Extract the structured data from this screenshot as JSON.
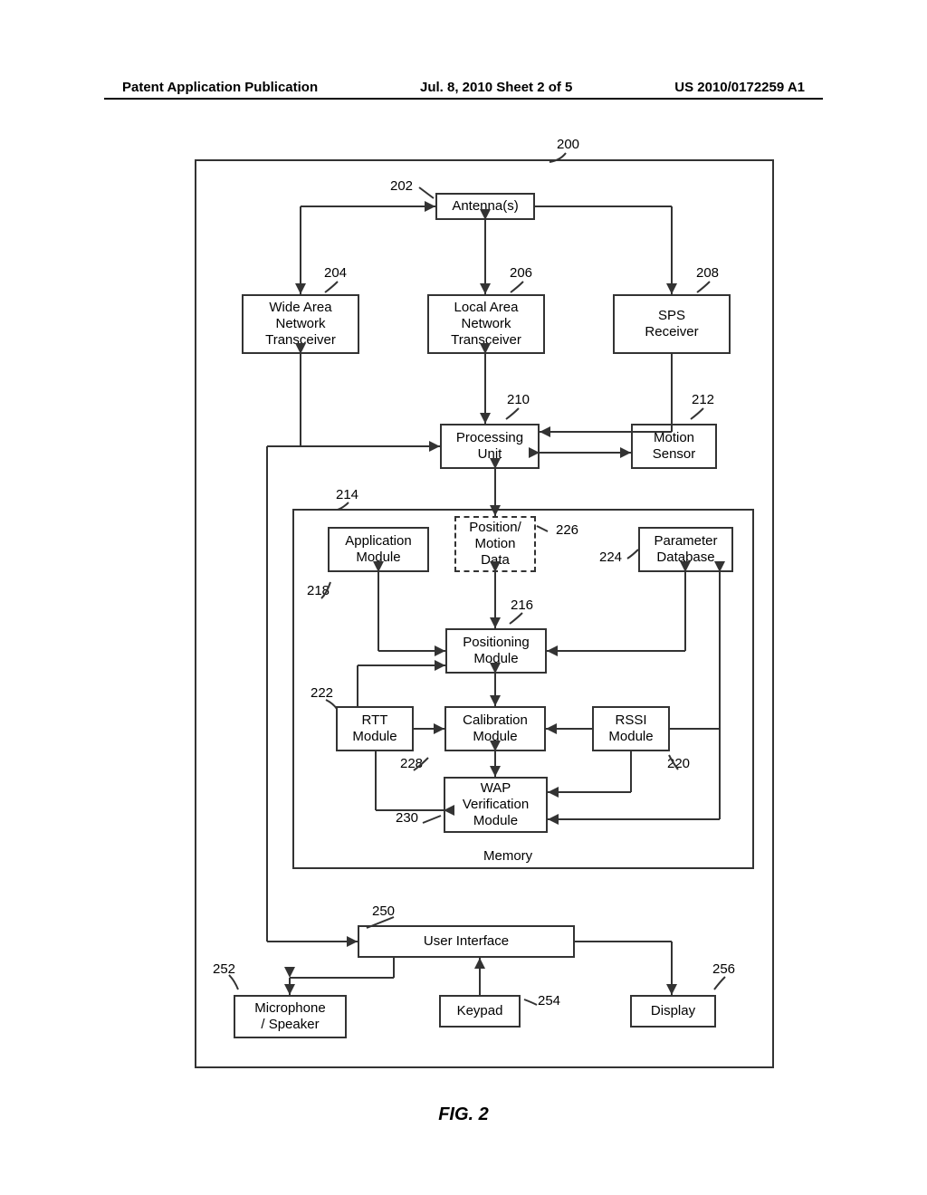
{
  "header": {
    "left": "Patent Application Publication",
    "center": "Jul. 8, 2010  Sheet 2 of 5",
    "right": "US 2010/0172259 A1"
  },
  "labels": {
    "l200": "200",
    "l202": "202",
    "l204": "204",
    "l206": "206",
    "l208": "208",
    "l210": "210",
    "l212": "212",
    "l214": "214",
    "l216": "216",
    "l218": "218",
    "l220": "220",
    "l222": "222",
    "l224": "224",
    "l226": "226",
    "l228": "228",
    "l230": "230",
    "l250": "250",
    "l252": "252",
    "l254": "254",
    "l256": "256"
  },
  "blocks": {
    "antenna": "Antenna(s)",
    "wan": "Wide Area\nNetwork\nTransceiver",
    "lan": "Local Area\nNetwork\nTransceiver",
    "sps": "SPS\nReceiver",
    "proc": "Processing\nUnit",
    "motion": "Motion\nSensor",
    "app": "Application\nModule",
    "pmd": "Position/\nMotion\nData",
    "param": "Parameter\nDatabase",
    "posmod": "Positioning\nModule",
    "rtt": "RTT\nModule",
    "cal": "Calibration\nModule",
    "rssi": "RSSI\nModule",
    "wap": "WAP\nVerification\nModule",
    "memory": "Memory",
    "ui": "User Interface",
    "mic": "Microphone\n/ Speaker",
    "keypad": "Keypad",
    "display": "Display"
  },
  "caption": "FIG. 2"
}
